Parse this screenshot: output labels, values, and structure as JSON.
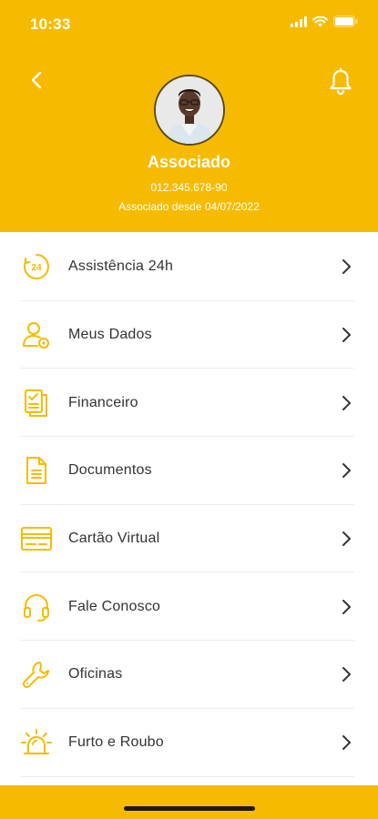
{
  "status_bar": {
    "time": "10:33"
  },
  "header": {
    "name": "Associado",
    "document": "012.345.678-90",
    "member_since": "Associado desde 04/07/2022"
  },
  "menu": {
    "items": [
      {
        "label": "Assistência 24h",
        "icon": "clock-24h-icon"
      },
      {
        "label": "Meus Dados",
        "icon": "user-settings-icon"
      },
      {
        "label": "Financeiro",
        "icon": "finance-documents-icon"
      },
      {
        "label": "Documentos",
        "icon": "document-icon"
      },
      {
        "label": "Cartão Virtual",
        "icon": "card-icon"
      },
      {
        "label": "Fale Conosco",
        "icon": "headset-icon"
      },
      {
        "label": "Oficinas",
        "icon": "wrench-icon"
      },
      {
        "label": "Furto e Roubo",
        "icon": "alarm-siren-icon"
      }
    ]
  },
  "colors": {
    "accent": "#F6BB00",
    "text": "#333333",
    "divider": "#ececec"
  }
}
